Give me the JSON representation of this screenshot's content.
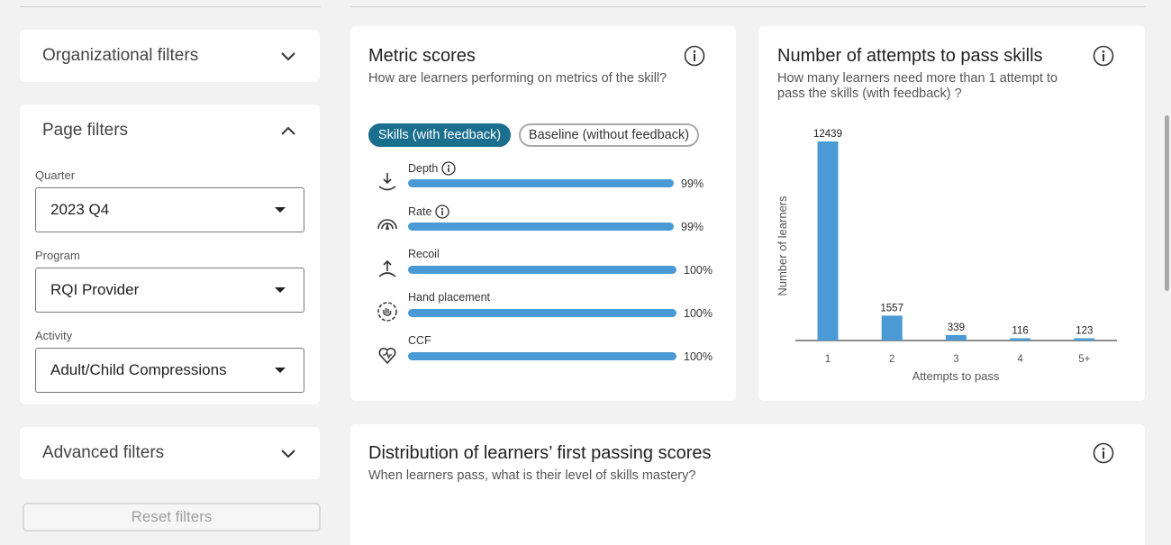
{
  "sidebar": {
    "organizational_filters": "Organizational filters",
    "page_filters": "Page filters",
    "quarter": {
      "label": "Quarter",
      "value": "2023 Q4"
    },
    "program": {
      "label": "Program",
      "value": "RQI Provider"
    },
    "activity": {
      "label": "Activity",
      "value": "Adult/Child Compressions"
    },
    "advanced_filters": "Advanced filters",
    "reset_label": "Reset filters"
  },
  "metric_scores": {
    "title": "Metric scores",
    "subtitle": "How are learners performing on metrics of the skill?",
    "toggle_on": "Skills (with feedback)",
    "toggle_off": "Baseline (without feedback)",
    "metrics": [
      {
        "label": "Depth",
        "value": "99%",
        "fraction": 0.99,
        "icon": "depth-icon",
        "has_info": true
      },
      {
        "label": "Rate",
        "value": "99%",
        "fraction": 0.99,
        "icon": "rate-icon",
        "has_info": true
      },
      {
        "label": "Recoil",
        "value": "100%",
        "fraction": 1.0,
        "icon": "recoil-icon",
        "has_info": false
      },
      {
        "label": "Hand placement",
        "value": "100%",
        "fraction": 1.0,
        "icon": "hand-placement-icon",
        "has_info": false
      },
      {
        "label": "CCF",
        "value": "100%",
        "fraction": 1.0,
        "icon": "ccf-heart-icon",
        "has_info": false
      }
    ],
    "bar_color": "#4a9ad5",
    "toggle_color": "#1a6e8e"
  },
  "attempts": {
    "title": "Number of attempts to pass skills",
    "subtitle_line1": "How many learners need more than 1 attempt to",
    "subtitle_line2": "pass the skills (with feedback) ?"
  },
  "chart_data": {
    "type": "bar",
    "categories": [
      "1",
      "2",
      "3",
      "4",
      "5+"
    ],
    "values": [
      12439,
      1557,
      339,
      116,
      123
    ],
    "xlabel": "Attempts to pass",
    "ylabel": "Number of learners",
    "ylim": [
      0,
      12439
    ],
    "grid": false,
    "bar_color": "#4a9ad5"
  },
  "distribution": {
    "title": "Distribution of learners’ first passing scores",
    "subtitle": "When learners pass, what is their level of skills mastery?"
  }
}
